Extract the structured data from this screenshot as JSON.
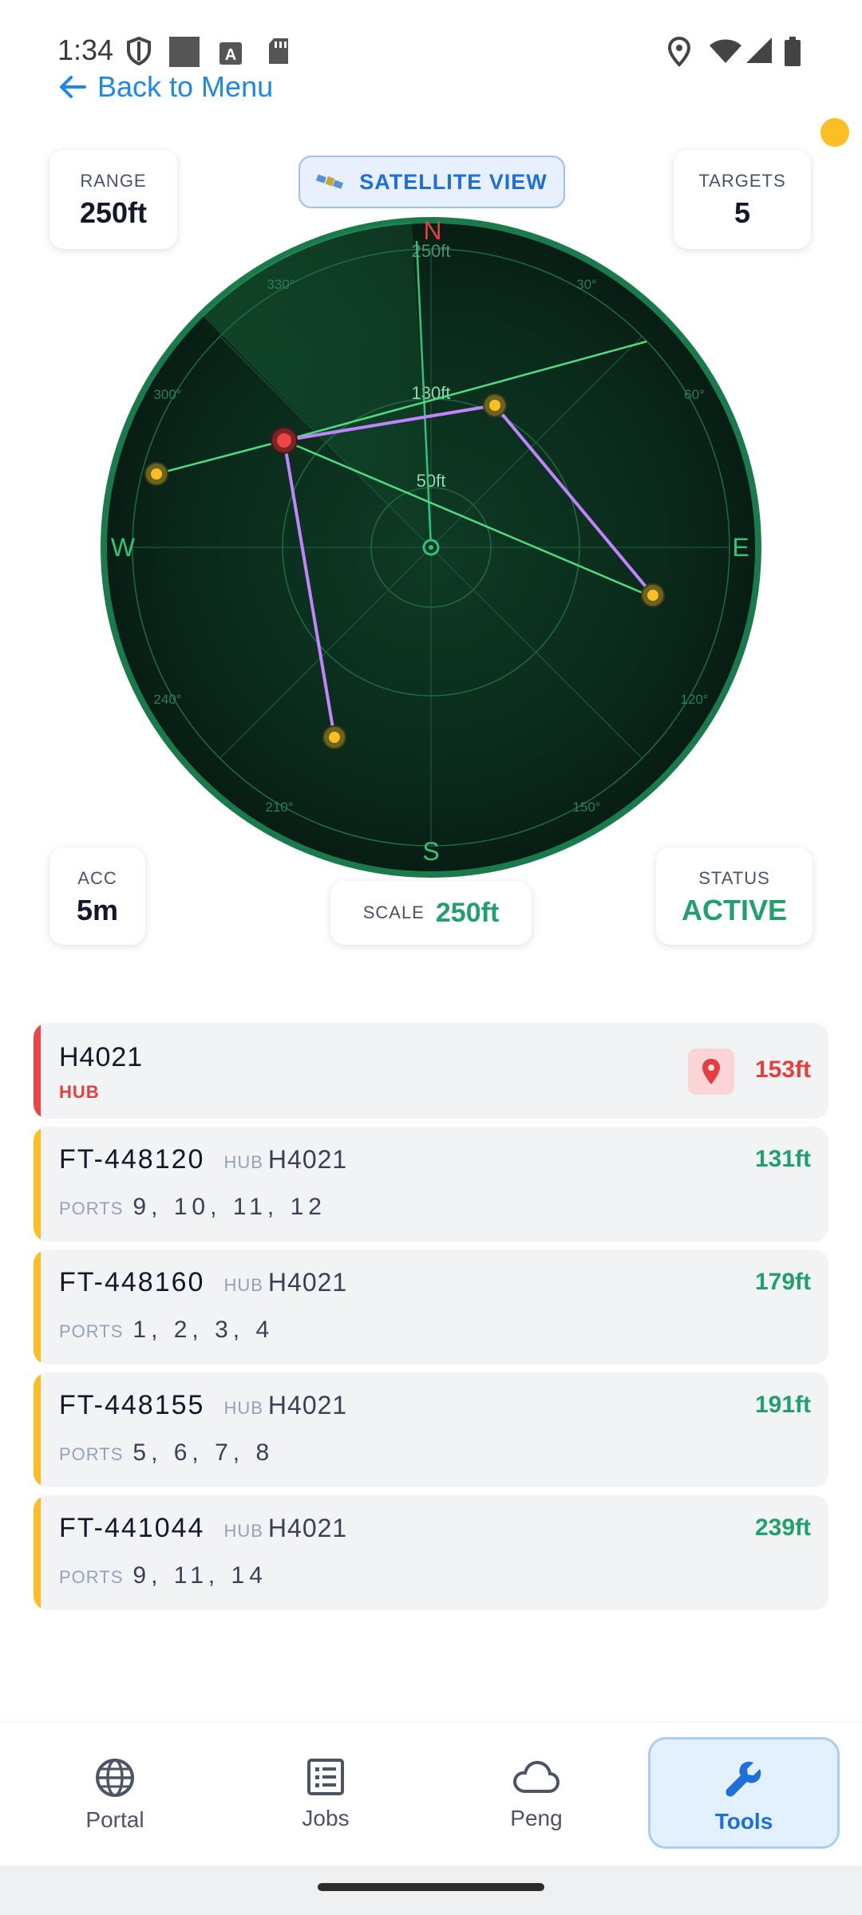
{
  "status_bar": {
    "time": "1:34"
  },
  "header": {
    "back_label": "Back to Menu"
  },
  "stats": {
    "range": {
      "label": "RANGE",
      "value": "250ft"
    },
    "targets": {
      "label": "TARGETS",
      "value": "5"
    },
    "acc": {
      "label": "ACC",
      "value": "5m"
    },
    "status": {
      "label": "STATUS",
      "value": "ACTIVE"
    },
    "scale": {
      "label": "SCALE",
      "value": "250ft"
    }
  },
  "satellite_button": {
    "label": "SATELLITE VIEW"
  },
  "radar": {
    "cardinals": {
      "n": "N",
      "e": "E",
      "s": "S",
      "w": "W"
    },
    "ring_labels": [
      "50ft",
      "130ft",
      "250ft"
    ],
    "degree_labels": [
      "30°",
      "60°",
      "120°",
      "150°",
      "210°",
      "240°",
      "300°",
      "330°"
    ]
  },
  "hub": {
    "id": "H4021",
    "type": "HUB",
    "distance": "153ft"
  },
  "terminals": [
    {
      "id": "FT-448120",
      "hub_label": "HUB",
      "hub": "H4021",
      "ports_label": "PORTS",
      "ports": "9, 10, 11, 12",
      "distance": "131ft"
    },
    {
      "id": "FT-448160",
      "hub_label": "HUB",
      "hub": "H4021",
      "ports_label": "PORTS",
      "ports": "1, 2, 3, 4",
      "distance": "179ft"
    },
    {
      "id": "FT-448155",
      "hub_label": "HUB",
      "hub": "H4021",
      "ports_label": "PORTS",
      "ports": "5, 6, 7, 8",
      "distance": "191ft"
    },
    {
      "id": "FT-441044",
      "hub_label": "HUB",
      "hub": "H4021",
      "ports_label": "PORTS",
      "ports": "9, 11, 14",
      "distance": "239ft"
    }
  ],
  "nav": {
    "portal": "Portal",
    "jobs": "Jobs",
    "peng": "Peng",
    "tools": "Tools"
  },
  "colors": {
    "accent": "#1e6fd9",
    "status_active": "#22a06b",
    "hub": "#e53e3e",
    "terminal": "#fbbf24",
    "radar_bg": "#0b2418"
  }
}
